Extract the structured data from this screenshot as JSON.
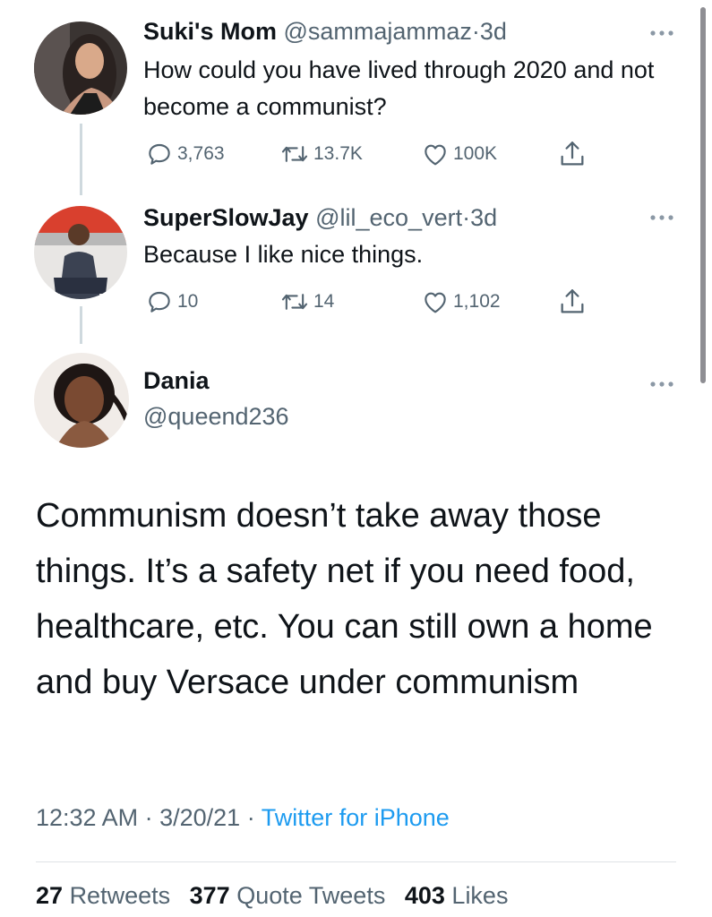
{
  "tweets": [
    {
      "name": "Suki's Mom",
      "handle": "@sammajammaz",
      "separator": "·",
      "time": "3d",
      "text": "How could you have lived through 2020 and not become a communist?",
      "avatar_icon": "user-photo-avatar",
      "replies": "3,763",
      "retweets": "13.7K",
      "likes": "100K"
    },
    {
      "name": "SuperSlowJay",
      "handle": "@lil_eco_vert",
      "separator": "·",
      "time": "3d",
      "text": "Because I like nice things.",
      "avatar_icon": "user-photo-avatar",
      "replies": "10",
      "retweets": "14",
      "likes": "1,102"
    }
  ],
  "main_tweet": {
    "name": "Dania",
    "handle": "@queend236",
    "text": "Communism doesn’t take away those things. It’s a safety net if you need food, healthcare, etc. You can still own a home and buy Versace under communism",
    "time": "12:32 AM",
    "separator": "·",
    "date": "3/20/21",
    "source": "Twitter for iPhone",
    "retweets_count": "27",
    "retweets_label": "Retweets",
    "quote_count": "377",
    "quote_label": "Quote Tweets",
    "likes_count": "403",
    "likes_label": "Likes"
  },
  "colors": {
    "text": "#0f1419",
    "secondary": "#536471",
    "accent": "#1d9bf0",
    "thread_line": "#cfd9de"
  },
  "icons": [
    "reply-icon",
    "retweet-icon",
    "like-icon",
    "share-icon",
    "more-icon"
  ]
}
